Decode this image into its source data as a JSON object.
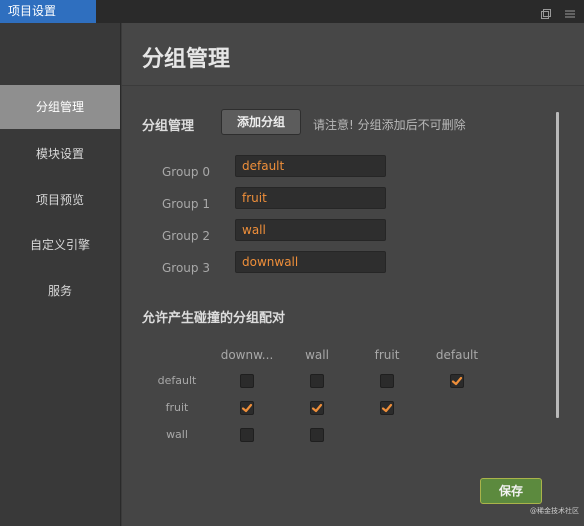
{
  "window": {
    "tab_title": "项目设置",
    "icons": [
      "window-icon",
      "menu-icon"
    ]
  },
  "sidebar": {
    "items": [
      {
        "label": "分组管理",
        "active": true
      },
      {
        "label": "模块设置",
        "active": false
      },
      {
        "label": "项目预览",
        "active": false
      },
      {
        "label": "自定义引擎",
        "active": false
      },
      {
        "label": "服务",
        "active": false
      }
    ]
  },
  "main": {
    "page_title": "分组管理",
    "groups_section": {
      "label": "分组管理",
      "add_button": "添加分组",
      "hint": "请注意! 分组添加后不可删除",
      "groups": [
        {
          "label": "Group 0",
          "value": "default"
        },
        {
          "label": "Group 1",
          "value": "fruit"
        },
        {
          "label": "Group 2",
          "value": "wall"
        },
        {
          "label": "Group 3",
          "value": "downwall"
        }
      ]
    },
    "collision_section": {
      "label": "允许产生碰撞的分组配对",
      "columns": [
        "downw...",
        "wall",
        "fruit",
        "default"
      ],
      "rows": [
        {
          "label": "default",
          "checks": [
            false,
            false,
            false,
            true
          ]
        },
        {
          "label": "fruit",
          "checks": [
            true,
            true,
            true
          ]
        },
        {
          "label": "wall",
          "checks": [
            false,
            false
          ]
        }
      ]
    },
    "save_button": "保存",
    "watermark": "@稀金技术社区"
  },
  "colors": {
    "accent": "#ef8f3a",
    "tab": "#2f6fbf",
    "save": "#5c8a3e"
  }
}
